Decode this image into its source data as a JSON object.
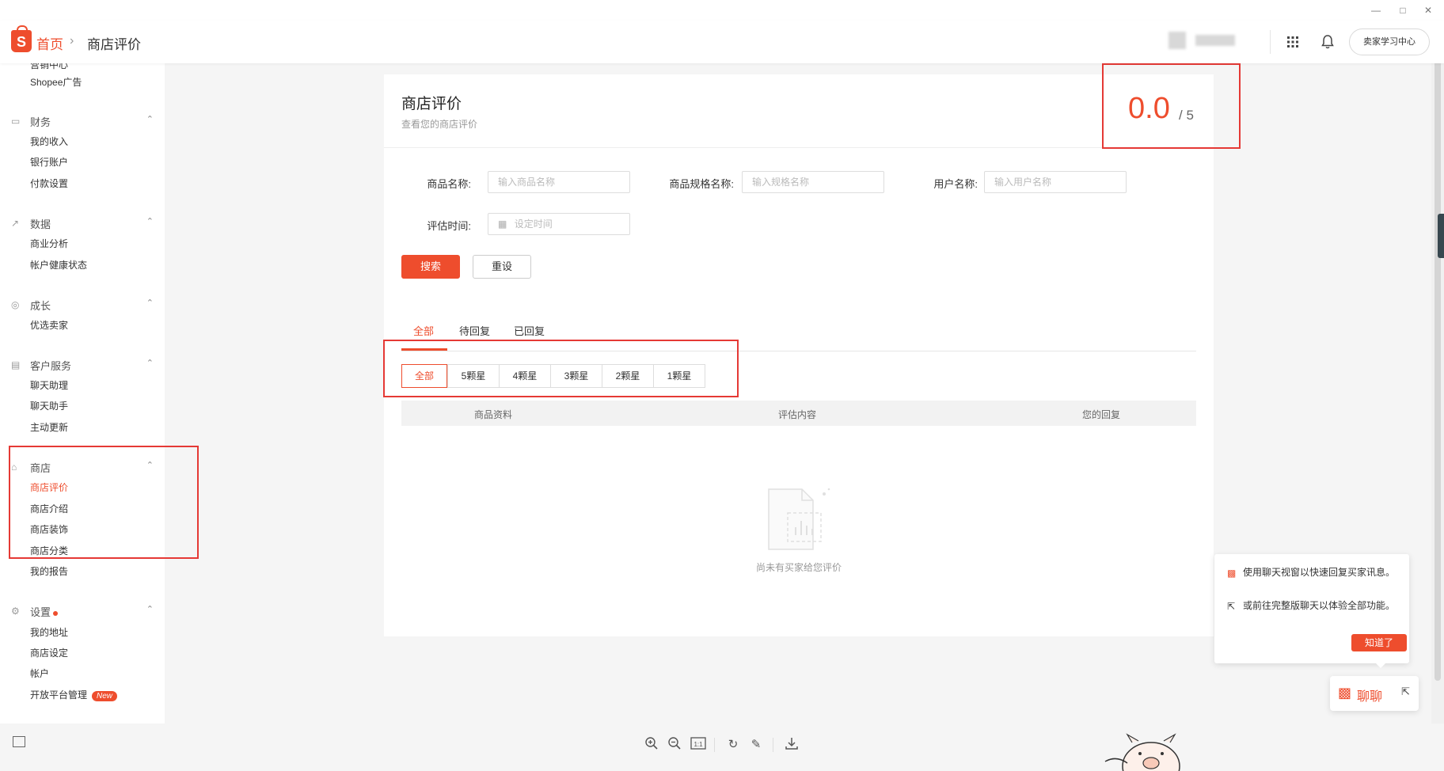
{
  "window": {
    "min_icon": "minimize-icon",
    "max_icon": "maximize-icon",
    "close_icon": "close-icon"
  },
  "header": {
    "logo_letter": "S",
    "breadcrumb_home": "首页",
    "breadcrumb_sep": "›",
    "breadcrumb_current": "商店评价",
    "learning_center": "卖家学习中心",
    "apps_icon": "grid-icon",
    "bell_icon": "bell-icon"
  },
  "sidebar": {
    "top_partial": "营销中心",
    "ads": "Shopee广告",
    "finance": {
      "title": "财务",
      "items": [
        "我的收入",
        "银行账户",
        "付款设置"
      ]
    },
    "data": {
      "title": "数据",
      "items": [
        "商业分析",
        "帐户健康状态"
      ]
    },
    "growth": {
      "title": "成长",
      "items": [
        "优选卖家"
      ]
    },
    "service": {
      "title": "客户服务",
      "items": [
        "聊天助理",
        "聊天助手",
        "主动更新"
      ]
    },
    "shop": {
      "title": "商店",
      "items": [
        "商店评价",
        "商店介绍",
        "商店装饰",
        "商店分类",
        "我的报告"
      ]
    },
    "settings": {
      "title": "设置",
      "items": [
        "我的地址",
        "商店设定",
        "帐户",
        "开放平台管理"
      ]
    },
    "new_badge": "New"
  },
  "main": {
    "title": "商店评价",
    "subtitle": "查看您的商店评价",
    "score": "0.0",
    "score_max": "/ 5",
    "filters": {
      "product_name_label": "商品名称:",
      "product_name_placeholder": "输入商品名称",
      "variation_label": "商品规格名称:",
      "variation_placeholder": "输入规格名称",
      "user_label": "用户名称:",
      "user_placeholder": "输入用户名称",
      "time_label": "评估时间:",
      "time_placeholder": "设定时间"
    },
    "search_btn": "搜索",
    "reset_btn": "重设",
    "tabs": [
      "全部",
      "待回复",
      "已回复"
    ],
    "star_filters": [
      "全部",
      "5颗星",
      "4颗星",
      "3颗星",
      "2颗星",
      "1颗星"
    ],
    "table_headers": [
      "商品资料",
      "评估内容",
      "您的回复"
    ],
    "empty_text": "尚未有买家给您评价"
  },
  "chat": {
    "tip1": "使用聊天视窗以快速回复买家讯息。",
    "tip2": "或前往完整版聊天以体验全部功能。",
    "got_it": "知道了",
    "chat_label": "聊聊"
  },
  "colors": {
    "accent": "#ee4d2d",
    "annotation": "#e53935"
  }
}
